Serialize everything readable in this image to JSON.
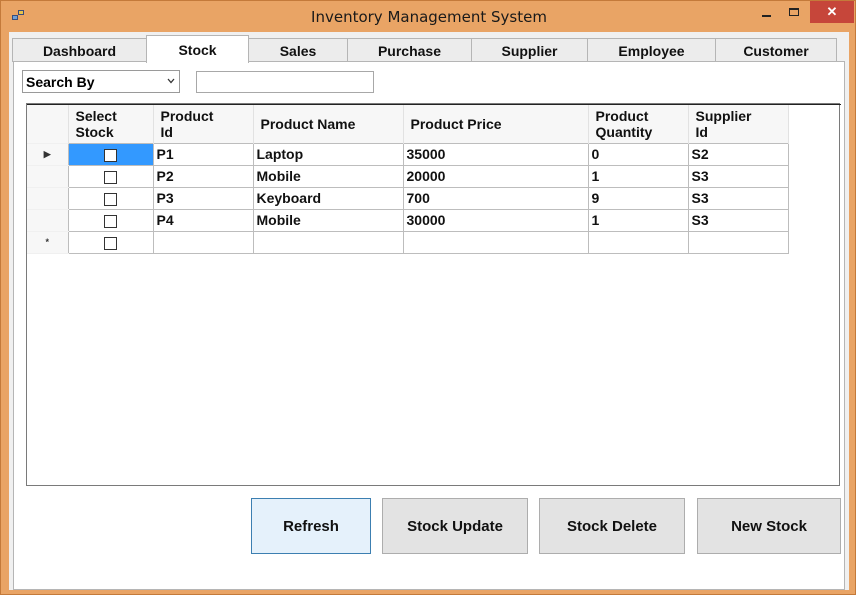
{
  "window": {
    "title": "Inventory Management System"
  },
  "tabs": [
    {
      "label": "Dashboard"
    },
    {
      "label": "Stock"
    },
    {
      "label": "Sales"
    },
    {
      "label": "Purchase"
    },
    {
      "label": "Supplier"
    },
    {
      "label": "Employee"
    },
    {
      "label": "Customer"
    }
  ],
  "active_tab": "Stock",
  "search": {
    "by_label": "Search By",
    "text": ""
  },
  "grid": {
    "columns": {
      "select_stock_1": "Select",
      "select_stock_2": "Stock",
      "product_id_1": "Product",
      "product_id_2": "Id",
      "product_name": "Product Name",
      "product_price": "Product Price",
      "product_qty_1": "Product",
      "product_qty_2": "Quantity",
      "supplier_id_1": "Supplier",
      "supplier_id_2": "Id"
    },
    "rows": [
      {
        "id": "P1",
        "name": "Laptop",
        "price": "35000",
        "qty": "0",
        "supplier": "S2"
      },
      {
        "id": "P2",
        "name": "Mobile",
        "price": "20000",
        "qty": "1",
        "supplier": "S3"
      },
      {
        "id": "P3",
        "name": "Keyboard",
        "price": "700",
        "qty": "9",
        "supplier": "S3"
      },
      {
        "id": "P4",
        "name": "Mobile",
        "price": "30000",
        "qty": "1",
        "supplier": "S3"
      }
    ],
    "new_row_marker": "*"
  },
  "buttons": {
    "refresh": "Refresh",
    "stock_update": "Stock Update",
    "stock_delete": "Stock Delete",
    "new_stock": "New Stock"
  },
  "colors": {
    "frame": "#e9a465",
    "close": "#c6463a",
    "selection": "#3399ff"
  }
}
